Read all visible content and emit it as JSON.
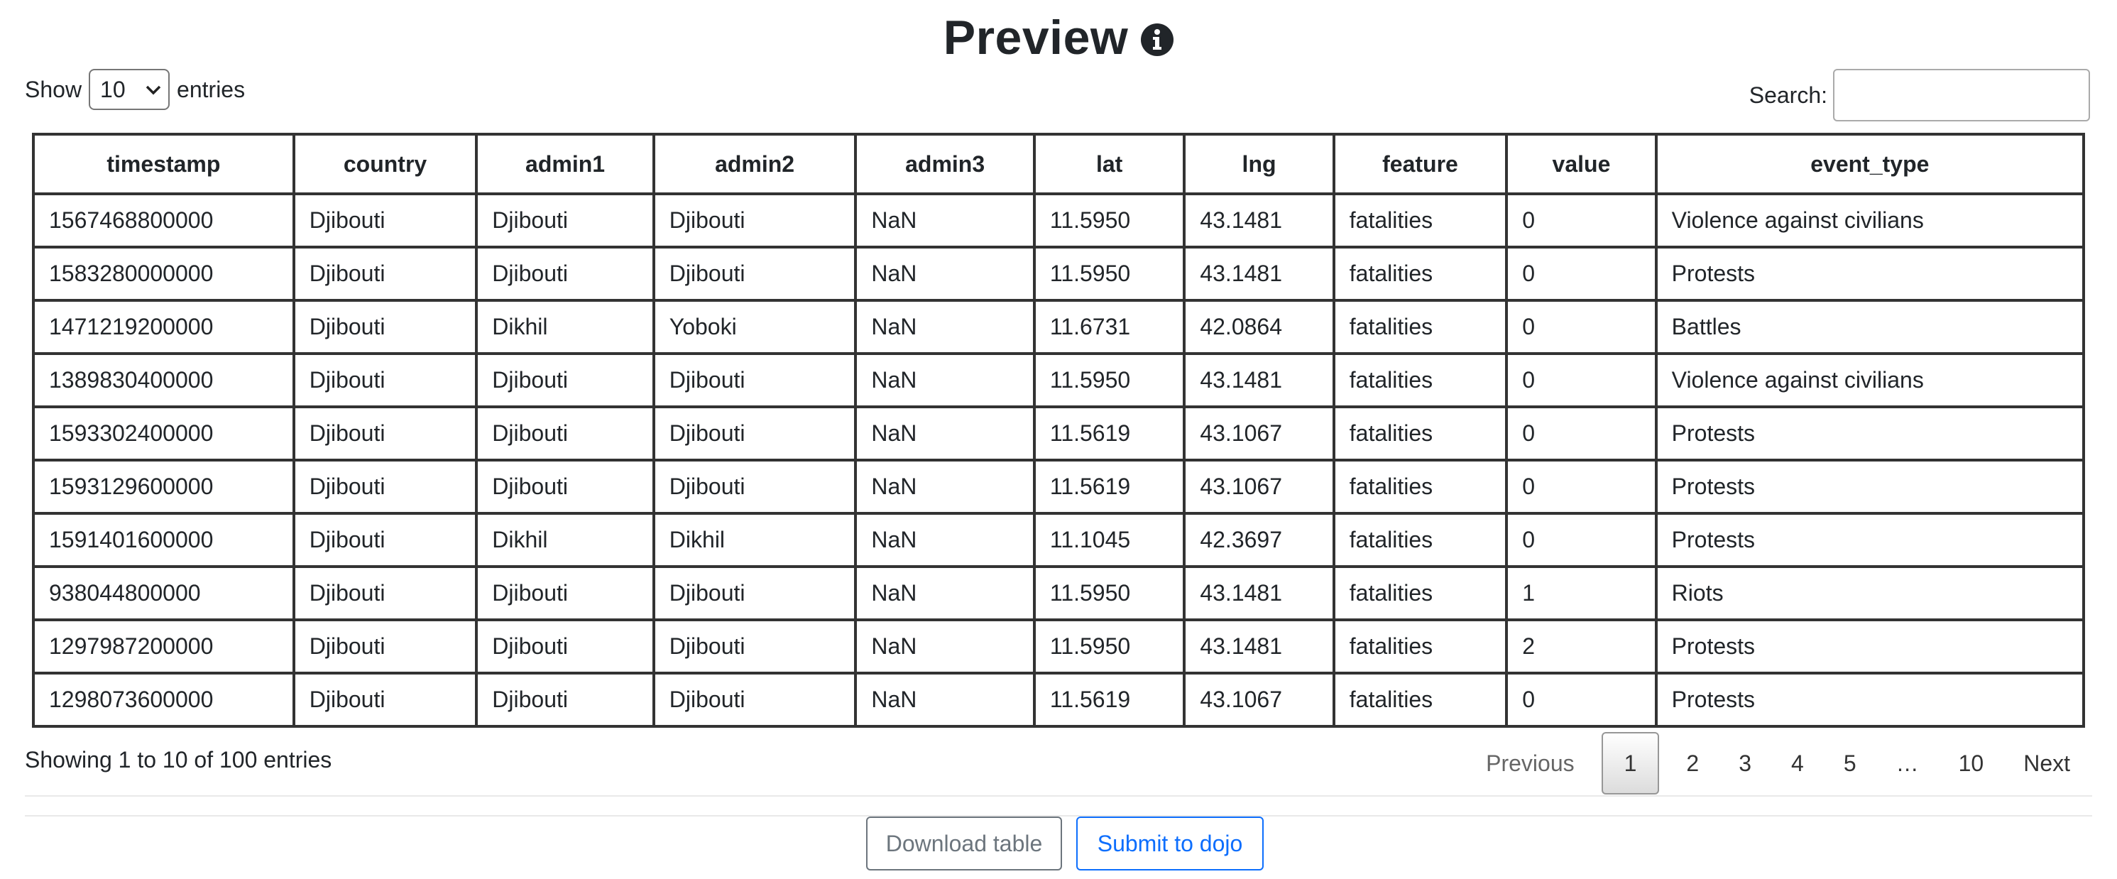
{
  "header": {
    "title": "Preview",
    "info_icon": "info-circle-icon"
  },
  "length_control": {
    "prefix": "Show",
    "selected": "10",
    "suffix": "entries"
  },
  "search": {
    "label": "Search:",
    "value": "",
    "placeholder": ""
  },
  "table": {
    "columns": [
      "timestamp",
      "country",
      "admin1",
      "admin2",
      "admin3",
      "lat",
      "lng",
      "feature",
      "value",
      "event_type"
    ],
    "rows": [
      [
        "1567468800000",
        "Djibouti",
        "Djibouti",
        "Djibouti",
        "NaN",
        "11.5950",
        "43.1481",
        "fatalities",
        "0",
        "Violence against civilians"
      ],
      [
        "1583280000000",
        "Djibouti",
        "Djibouti",
        "Djibouti",
        "NaN",
        "11.5950",
        "43.1481",
        "fatalities",
        "0",
        "Protests"
      ],
      [
        "1471219200000",
        "Djibouti",
        "Dikhil",
        "Yoboki",
        "NaN",
        "11.6731",
        "42.0864",
        "fatalities",
        "0",
        "Battles"
      ],
      [
        "1389830400000",
        "Djibouti",
        "Djibouti",
        "Djibouti",
        "NaN",
        "11.5950",
        "43.1481",
        "fatalities",
        "0",
        "Violence against civilians"
      ],
      [
        "1593302400000",
        "Djibouti",
        "Djibouti",
        "Djibouti",
        "NaN",
        "11.5619",
        "43.1067",
        "fatalities",
        "0",
        "Protests"
      ],
      [
        "1593129600000",
        "Djibouti",
        "Djibouti",
        "Djibouti",
        "NaN",
        "11.5619",
        "43.1067",
        "fatalities",
        "0",
        "Protests"
      ],
      [
        "1591401600000",
        "Djibouti",
        "Dikhil",
        "Dikhil",
        "NaN",
        "11.1045",
        "42.3697",
        "fatalities",
        "0",
        "Protests"
      ],
      [
        "938044800000",
        "Djibouti",
        "Djibouti",
        "Djibouti",
        "NaN",
        "11.5950",
        "43.1481",
        "fatalities",
        "1",
        "Riots"
      ],
      [
        "1297987200000",
        "Djibouti",
        "Djibouti",
        "Djibouti",
        "NaN",
        "11.5950",
        "43.1481",
        "fatalities",
        "2",
        "Protests"
      ],
      [
        "1298073600000",
        "Djibouti",
        "Djibouti",
        "Djibouti",
        "NaN",
        "11.5619",
        "43.1067",
        "fatalities",
        "0",
        "Protests"
      ]
    ]
  },
  "footer": {
    "info": "Showing 1 to 10 of 100 entries"
  },
  "pagination": {
    "previous": "Previous",
    "pages": [
      "1",
      "2",
      "3",
      "4",
      "5",
      "…",
      "10"
    ],
    "current": "1",
    "next": "Next"
  },
  "actions": {
    "download": "Download table",
    "submit": "Submit to dojo"
  }
}
